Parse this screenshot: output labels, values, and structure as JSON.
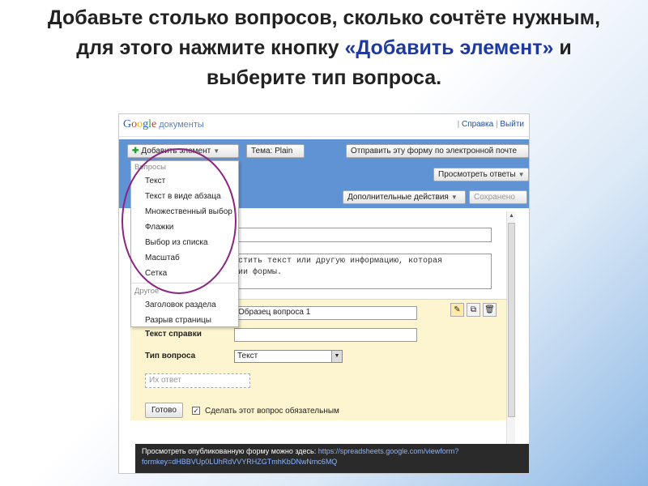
{
  "slide": {
    "title_part1": "Добавьте столько вопросов, сколько сочтёте нужным, для этого нажмите кнопку ",
    "title_highlight": "«Добавить элемент»",
    "title_part2": " и выберите тип вопроса."
  },
  "app": {
    "logo_letters": [
      "G",
      "o",
      "o",
      "g",
      "l",
      "e"
    ],
    "docs_label": "документы",
    "help_link": "Справка",
    "logout_link": "Выйти",
    "separator": "|"
  },
  "toolbar": {
    "add_item_label": "Добавить элемент",
    "theme_label": "Тема:  Plain",
    "send_label": "Отправить эту форму по электронной почте",
    "view_responses_label": "Просмотреть ответы",
    "more_actions_label": "Дополнительные действия",
    "saved_label": "Сохранено"
  },
  "dropdown": {
    "questions_header": "Вопросы",
    "question_items": [
      "Текст",
      "Текст в виде абзаца",
      "Множественный выбор",
      "Флажки",
      "Выбор из списка",
      "Масштаб",
      "Сетка"
    ],
    "other_header": "Другое",
    "other_items": [
      "Заголовок раздела",
      "Разрыв страницы"
    ]
  },
  "form": {
    "description_text": "стить текст или другую информацию, которая\nии формы.",
    "question_title_value": "Образец вопроса 1",
    "help_text_label": "Текст справки",
    "help_text_value": "",
    "question_type_label": "Тип вопроса",
    "question_type_value": "Текст",
    "answer_placeholder": "Их ответ",
    "done_button": "Готово",
    "required_checked": true,
    "required_label": "Сделать этот вопрос обязательным"
  },
  "footer": {
    "text": "Просмотреть опубликованную форму можно здесь: ",
    "url_line1": "https://spreadsheets.google.com/viewform?",
    "url_line2": "formkey=dHBBVUp0LUhRdVVYRHZGTmhKbDNwNmc6MQ"
  },
  "colors": {
    "toolbar": "#5f93d3",
    "question_panel": "#fdf5cf",
    "circle": "#8b2580",
    "title_highlight": "#1f3a9e"
  }
}
